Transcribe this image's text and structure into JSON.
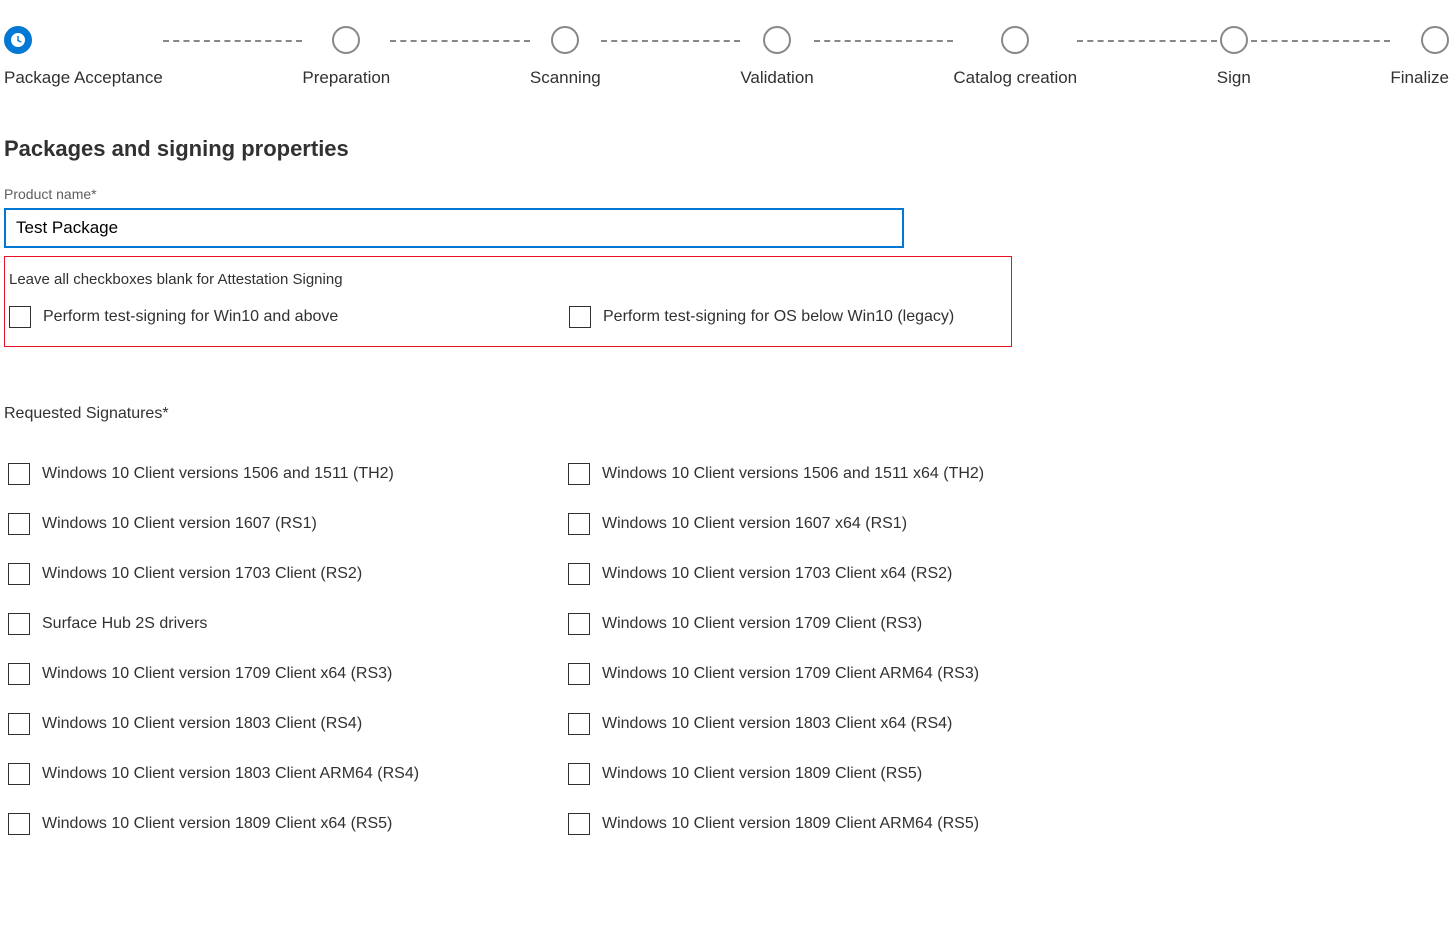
{
  "stepper": {
    "steps": [
      {
        "label": "Package Acceptance",
        "active": true
      },
      {
        "label": "Preparation",
        "active": false
      },
      {
        "label": "Scanning",
        "active": false
      },
      {
        "label": "Validation",
        "active": false
      },
      {
        "label": "Catalog creation",
        "active": false
      },
      {
        "label": "Sign",
        "active": false
      },
      {
        "label": "Finalize",
        "active": false
      }
    ]
  },
  "form": {
    "section_title": "Packages and signing properties",
    "product_name_label": "Product name*",
    "product_name_value": "Test Package",
    "attestation_note": "Leave all checkboxes blank for Attestation Signing",
    "test_sign_win10": "Perform test-signing for Win10 and above",
    "test_sign_legacy": "Perform test-signing for OS below Win10 (legacy)",
    "requested_signatures_label": "Requested Signatures*",
    "signatures_left": [
      "Windows 10 Client versions 1506 and 1511 (TH2)",
      "Windows 10 Client version 1607 (RS1)",
      "Windows 10 Client version 1703 Client (RS2)",
      "Surface Hub 2S drivers",
      "Windows 10 Client version 1709 Client x64 (RS3)",
      "Windows 10 Client version 1803 Client (RS4)",
      "Windows 10 Client version 1803 Client ARM64 (RS4)",
      "Windows 10 Client version 1809 Client x64 (RS5)"
    ],
    "signatures_right": [
      "Windows 10 Client versions 1506 and 1511 x64 (TH2)",
      "Windows 10 Client version 1607 x64 (RS1)",
      "Windows 10 Client version 1703 Client x64 (RS2)",
      "Windows 10 Client version 1709 Client (RS3)",
      "Windows 10 Client version 1709 Client ARM64 (RS3)",
      "Windows 10 Client version 1803 Client x64 (RS4)",
      "Windows 10 Client version 1809 Client (RS5)",
      "Windows 10 Client version 1809 Client ARM64 (RS5)"
    ]
  }
}
